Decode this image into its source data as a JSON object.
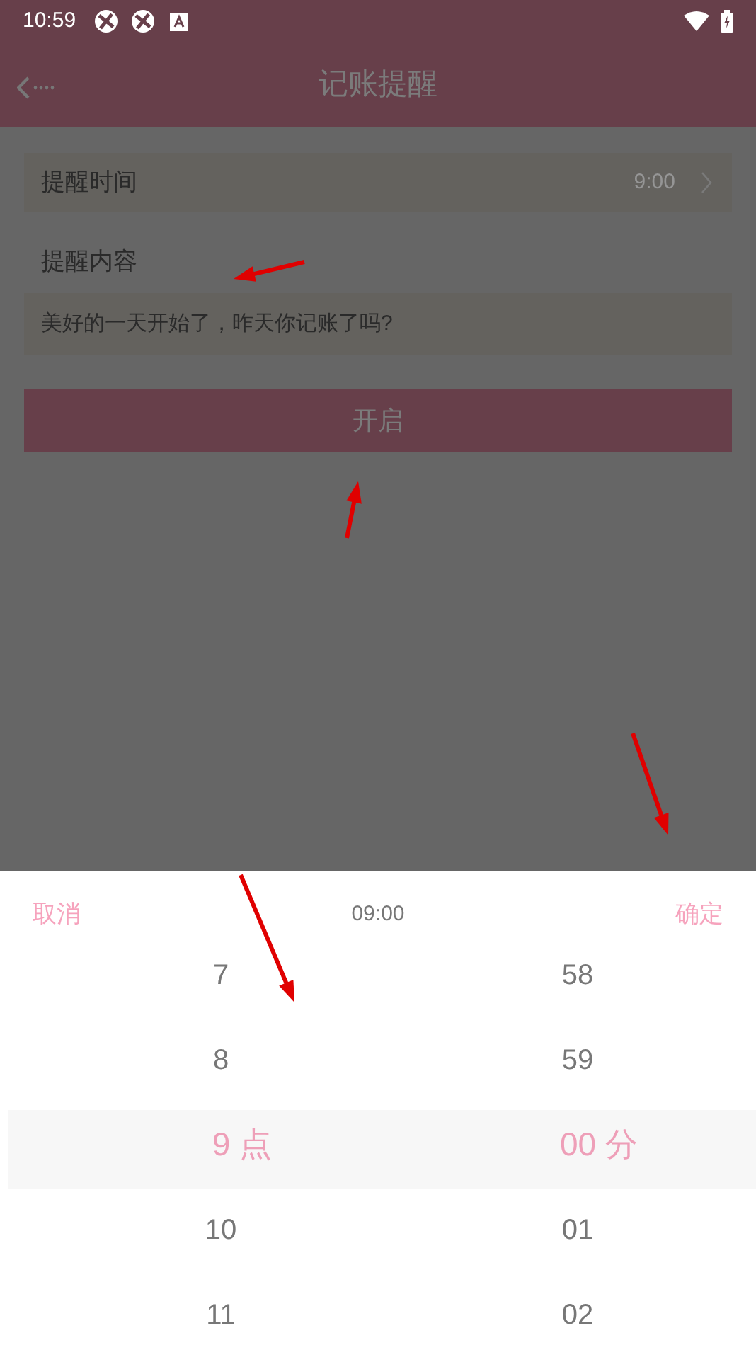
{
  "status_bar": {
    "time": "10:59"
  },
  "header": {
    "title": "记账提醒"
  },
  "reminder_time": {
    "label": "提醒时间",
    "value": "9:00"
  },
  "reminder_content": {
    "label": "提醒内容",
    "value": "美好的一天开始了，昨天你记账了吗?"
  },
  "enable_button": "开启",
  "picker": {
    "cancel": "取消",
    "title": "09:00",
    "confirm": "确定",
    "columns": [
      {
        "unit": "点",
        "items": [
          {
            "label": "7",
            "selected": false
          },
          {
            "label": "8",
            "selected": false
          },
          {
            "label": "9",
            "selected": true
          },
          {
            "label": "10",
            "selected": false
          },
          {
            "label": "11",
            "selected": false
          }
        ]
      },
      {
        "unit": "分",
        "items": [
          {
            "label": "58",
            "selected": false
          },
          {
            "label": "59",
            "selected": false
          },
          {
            "label": "00",
            "selected": true
          },
          {
            "label": "01",
            "selected": false
          },
          {
            "label": "02",
            "selected": false
          }
        ]
      }
    ]
  }
}
